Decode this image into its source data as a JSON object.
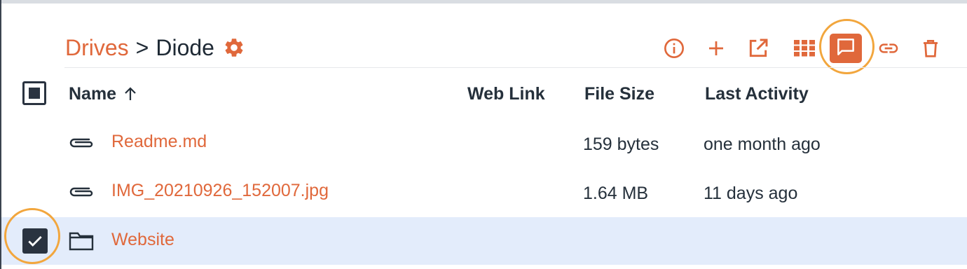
{
  "breadcrumb": {
    "root_label": "Drives",
    "separator": ">",
    "current_label": "Diode"
  },
  "toolbar": {
    "icons": [
      "info-icon",
      "add-icon",
      "open-external-icon",
      "grid-view-icon",
      "comment-icon",
      "link-icon",
      "trash-icon"
    ],
    "active_icon": "comment-icon"
  },
  "table": {
    "columns": {
      "name": "Name",
      "web_link": "Web Link",
      "file_size": "File Size",
      "last_activity": "Last Activity"
    },
    "sort_indicator": "ascending",
    "rows": [
      {
        "icon": "attachment-icon",
        "name": "Readme.md",
        "size": "159 bytes",
        "activity": "one month ago",
        "selected": false
      },
      {
        "icon": "attachment-icon",
        "name": "IMG_20210926_152007.jpg",
        "size": "1.64 MB",
        "activity": "11 days ago",
        "selected": false
      },
      {
        "icon": "folder-icon",
        "name": "Website",
        "size": "",
        "activity": "",
        "selected": true
      }
    ]
  },
  "colors": {
    "accent": "#e0683b",
    "highlight_ring": "#f2a63d",
    "selected_row": "#e3ecfb",
    "text": "#25303b"
  }
}
